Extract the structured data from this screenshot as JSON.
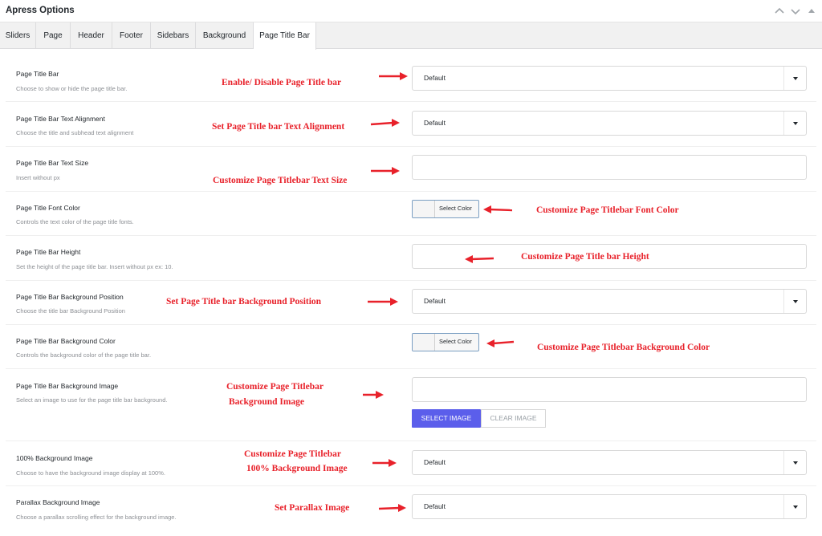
{
  "header": {
    "title": "Apress Options",
    "collapse_up_icon": "chevron-up-icon",
    "collapse_down_icon": "chevron-down-icon"
  },
  "tabs": [
    {
      "label": "Sliders"
    },
    {
      "label": "Page"
    },
    {
      "label": "Header"
    },
    {
      "label": "Footer"
    },
    {
      "label": "Sidebars"
    },
    {
      "label": "Background"
    },
    {
      "label": "Page Title Bar",
      "active": true
    }
  ],
  "fields": {
    "title_bar": {
      "label": "Page Title Bar",
      "desc": "Choose to show or hide the page title bar.",
      "value": "Default"
    },
    "text_alignment": {
      "label": "Page Title Bar Text Alignment",
      "desc": "Choose the title and subhead text alignment",
      "value": "Default"
    },
    "text_size": {
      "label": "Page Title Bar Text Size",
      "desc": "Insert without px",
      "value": ""
    },
    "font_color": {
      "label": "Page Title Font Color",
      "desc": "Controls the text color of the page title fonts.",
      "button": "Select Color"
    },
    "height": {
      "label": "Page Title Bar Height",
      "desc": "Set the height of the page title bar. Insert without px ex: 10.",
      "value": ""
    },
    "bg_position": {
      "label": "Page Title Bar Background Position",
      "desc": "Choose the title bar Background Position",
      "value": "Default"
    },
    "bg_color": {
      "label": "Page Title Bar Background Color",
      "desc": "Controls the background color of the page title bar.",
      "button": "Select Color"
    },
    "bg_image": {
      "label": "Page Title Bar Background Image",
      "desc": "Select an image to use for the page title bar background.",
      "value": "",
      "select_button": "SELECT IMAGE",
      "clear_button": "CLEAR IMAGE"
    },
    "full_bg": {
      "label": "100% Background Image",
      "desc": "Choose to have the background image display at 100%.",
      "value": "Default"
    },
    "parallax": {
      "label": "Parallax Background Image",
      "desc": "Choose a parallax scrolling effect for the background image.",
      "value": "Default"
    }
  },
  "annotations": {
    "title_bar": "Enable/ Disable Page Title bar",
    "text_alignment": "Set Page Title bar Text Alignment",
    "text_size": "Customize Page Titlebar Text Size",
    "font_color": "Customize Page Titlebar Font Color",
    "height": "Customize Page Title bar Height",
    "bg_position": "Set Page Title bar Background Position",
    "bg_color": "Customize Page Titlebar Background Color",
    "bg_image_1": "Customize Page Titlebar",
    "bg_image_2": "Background Image",
    "full_bg_1": "Customize Page Titlebar",
    "full_bg_2": "100% Background Image",
    "parallax": "Set Parallax Image"
  },
  "colors": {
    "annotation": "#e8212a",
    "primary_button": "#5b5eeb"
  }
}
